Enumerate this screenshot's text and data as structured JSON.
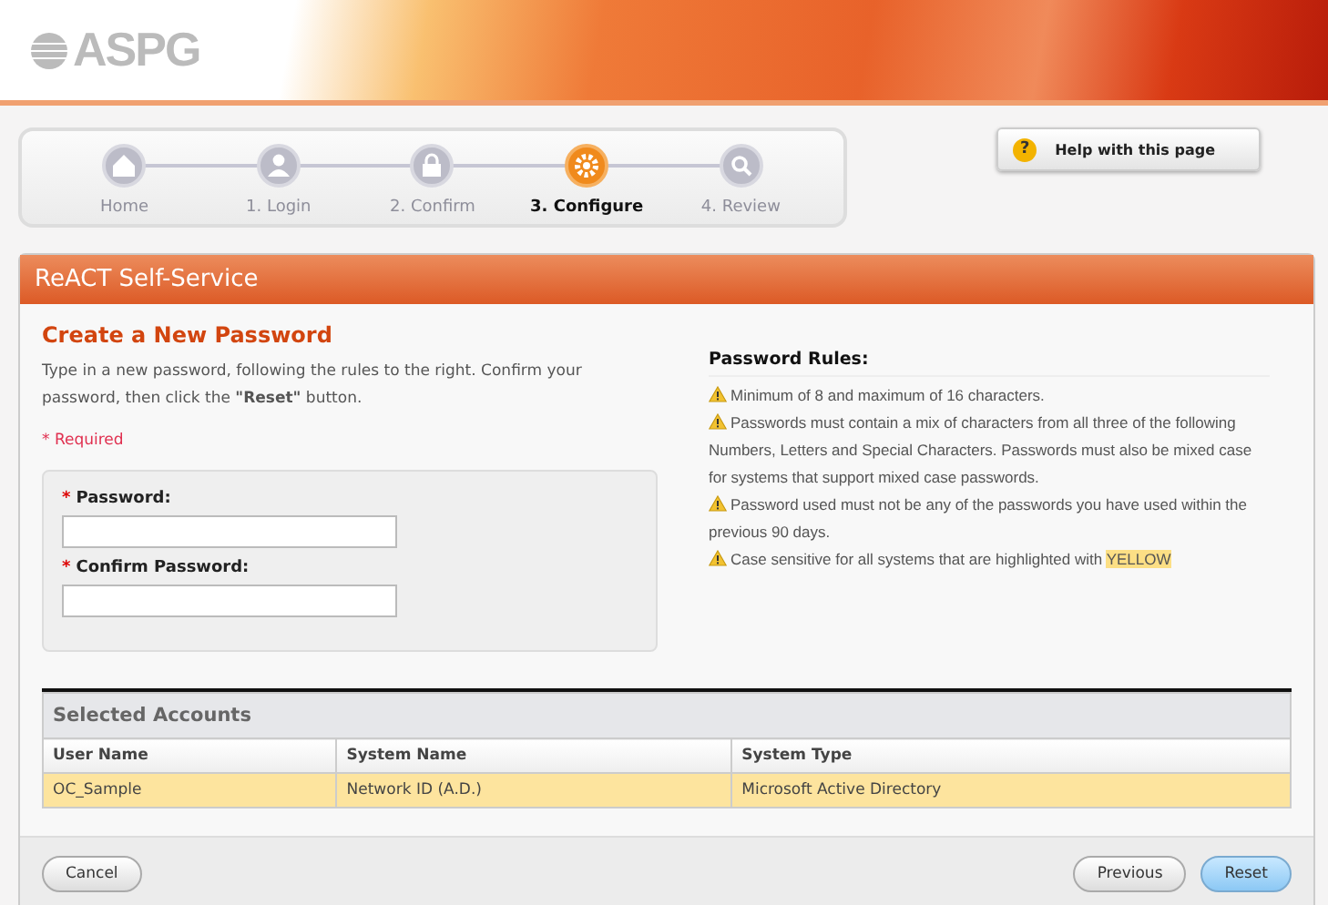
{
  "logo": "ASPG",
  "steps": [
    {
      "label": "Home",
      "selected": false
    },
    {
      "label": "1. Login",
      "selected": false
    },
    {
      "label": "2. Confirm",
      "selected": false
    },
    {
      "label": "3. Configure",
      "selected": true
    },
    {
      "label": "4. Review",
      "selected": false
    }
  ],
  "help_button": {
    "icon": "?",
    "label": "Help with this page"
  },
  "panel": {
    "title": "ReACT Self-Service",
    "heading": "Create a New Password",
    "description": "Type in a new password, following the rules to the right. Confirm your password, then click the **\"Reset\"** button.",
    "required_note": "* Required",
    "fields": [
      {
        "marker": "*",
        "label": "Password:"
      },
      {
        "marker": "*",
        "label": "Confirm Password:"
      }
    ],
    "rules_title": "Password Rules:",
    "rules": [
      {
        "text": "Minimum of 8 and maximum of 16 characters."
      },
      {
        "text": "Passwords must contain a mix of characters from all three of the following Numbers, Letters and Special Characters. Passwords must also be mixed case for systems that support mixed case passwords."
      },
      {
        "text": "Password used must not be any of the passwords you have used within the previous 90 days."
      },
      {
        "text": "Case sensitive for all systems that are highlighted with",
        "highlight": "YELLOW"
      }
    ],
    "table": {
      "title": "Selected Accounts",
      "columns": [
        "User Name",
        "System Name",
        "System Type"
      ],
      "rows": [
        {
          "cells": [
            "OC_Sample",
            "Network ID (A.D.)",
            "Microsoft Active Directory"
          ],
          "selected": true
        }
      ]
    },
    "buttons": {
      "cancel": "Cancel",
      "previous": "Previous",
      "reset": "Reset"
    }
  }
}
